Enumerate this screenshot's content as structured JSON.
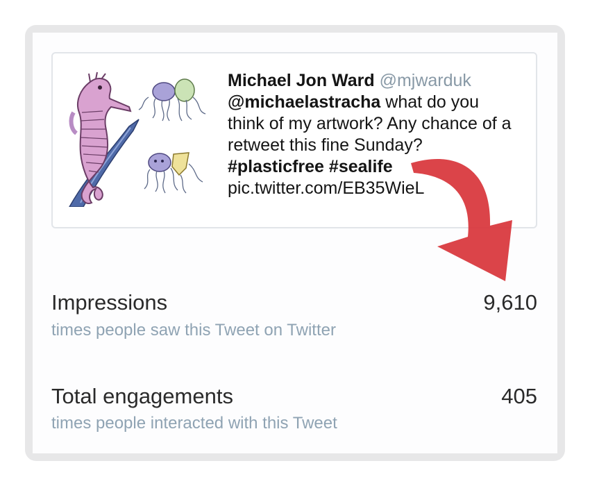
{
  "tweet": {
    "author_name": "Michael Jon Ward",
    "author_handle": "@mjwarduk",
    "mention": "@michaelastracha",
    "text_part1": " what do you think of my artwork? Any chance of a retweet this fine Sunday?",
    "hashtag1": "#plasticfree",
    "hashtag2": "#sealife",
    "link": "pic.twitter.com/EB35WieL"
  },
  "metrics": {
    "impressions": {
      "label": "Impressions",
      "description": "times people saw this Tweet on Twitter",
      "value": "9,610"
    },
    "engagements": {
      "label": "Total engagements",
      "description": "times people interacted with this Tweet",
      "value": "405"
    }
  },
  "colors": {
    "arrow": "#d8363b",
    "handle": "#8899a6",
    "subtext": "#8fa3b3",
    "card_border": "#e2e5e9",
    "frame": "#e7e7e8"
  }
}
